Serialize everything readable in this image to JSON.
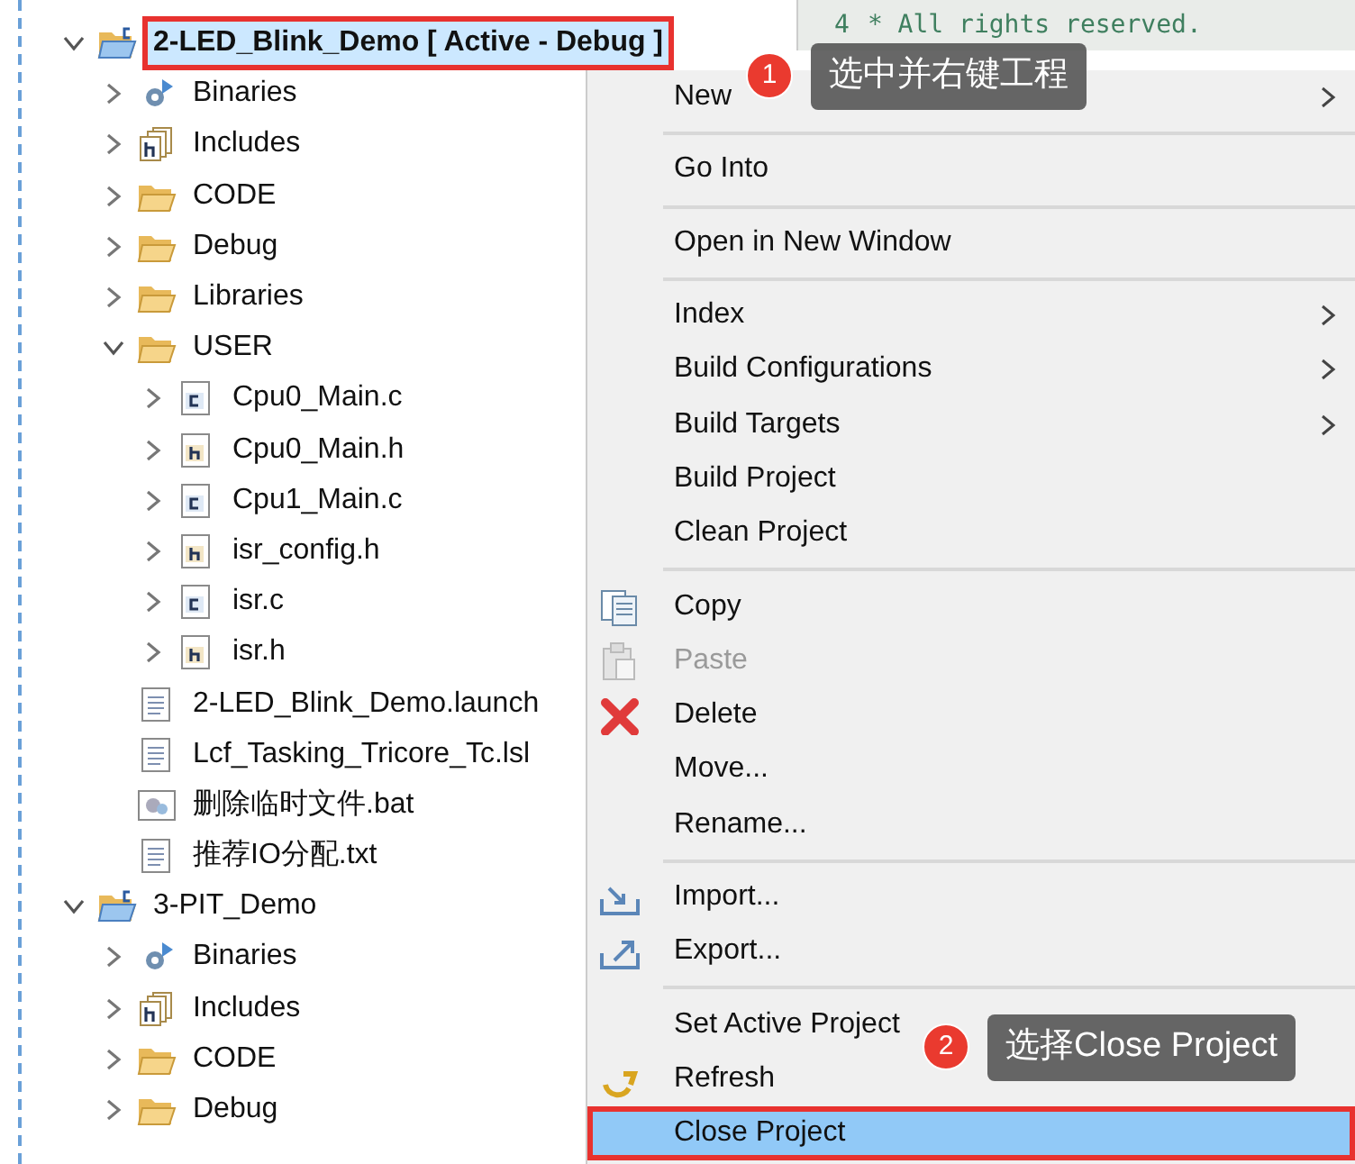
{
  "editor": {
    "line_number": "4",
    "code": "* All rights reserved."
  },
  "tree": [
    {
      "label": "2-LED_Blink_Demo [ Active - Debug ]",
      "kind": "project",
      "expanded": true,
      "selected": true,
      "highlighted": true,
      "children": [
        {
          "label": "Binaries",
          "kind": "binaries",
          "expanded": false,
          "selected": false
        },
        {
          "label": "Includes",
          "kind": "includes",
          "expanded": false,
          "selected": false
        },
        {
          "label": "CODE",
          "kind": "folder",
          "expanded": false,
          "selected": false
        },
        {
          "label": "Debug",
          "kind": "folder",
          "expanded": false,
          "selected": false
        },
        {
          "label": "Libraries",
          "kind": "folder",
          "expanded": false,
          "selected": false
        },
        {
          "label": "USER",
          "kind": "folder",
          "expanded": true,
          "selected": false,
          "children": [
            {
              "label": "Cpu0_Main.c",
              "kind": "c",
              "expanded": false,
              "selected": false
            },
            {
              "label": "Cpu0_Main.h",
              "kind": "h",
              "expanded": false,
              "selected": false
            },
            {
              "label": "Cpu1_Main.c",
              "kind": "c",
              "expanded": false,
              "selected": false
            },
            {
              "label": "isr_config.h",
              "kind": "h",
              "expanded": false,
              "selected": false
            },
            {
              "label": "isr.c",
              "kind": "c",
              "expanded": false,
              "selected": false
            },
            {
              "label": "isr.h",
              "kind": "h",
              "expanded": false,
              "selected": false
            }
          ]
        },
        {
          "label": "2-LED_Blink_Demo.launch",
          "kind": "file",
          "selected": false
        },
        {
          "label": "Lcf_Tasking_Tricore_Tc.lsl",
          "kind": "file",
          "selected": false
        },
        {
          "label": "删除临时文件.bat",
          "kind": "bat",
          "selected": false
        },
        {
          "label": "推荐IO分配.txt",
          "kind": "file",
          "selected": false
        }
      ]
    },
    {
      "label": "3-PIT_Demo",
      "kind": "project",
      "expanded": true,
      "selected": false,
      "highlighted": false,
      "children": [
        {
          "label": "Binaries",
          "kind": "binaries",
          "expanded": false,
          "selected": false
        },
        {
          "label": "Includes",
          "kind": "includes",
          "expanded": false,
          "selected": false
        },
        {
          "label": "CODE",
          "kind": "folder",
          "expanded": false,
          "selected": false
        },
        {
          "label": "Debug",
          "kind": "folder",
          "expanded": false,
          "selected": false
        }
      ]
    }
  ],
  "context_menu": [
    {
      "kind": "item",
      "label": "New",
      "submenu": true,
      "disabled": false,
      "selected": false
    },
    {
      "kind": "separator"
    },
    {
      "kind": "item",
      "label": "Go Into",
      "submenu": false,
      "disabled": false,
      "selected": false
    },
    {
      "kind": "separator"
    },
    {
      "kind": "item",
      "label": "Open in New Window",
      "submenu": false,
      "disabled": false,
      "selected": false
    },
    {
      "kind": "separator"
    },
    {
      "kind": "item",
      "label": "Index",
      "submenu": true,
      "disabled": false,
      "selected": false
    },
    {
      "kind": "item",
      "label": "Build Configurations",
      "submenu": true,
      "disabled": false,
      "selected": false
    },
    {
      "kind": "item",
      "label": "Build Targets",
      "submenu": true,
      "disabled": false,
      "selected": false
    },
    {
      "kind": "item",
      "label": "Build Project",
      "submenu": false,
      "disabled": false,
      "selected": false
    },
    {
      "kind": "item",
      "label": "Clean Project",
      "submenu": false,
      "disabled": false,
      "selected": false
    },
    {
      "kind": "separator"
    },
    {
      "kind": "copy",
      "label": "Copy",
      "submenu": false,
      "disabled": false,
      "selected": false
    },
    {
      "kind": "paste",
      "label": "Paste",
      "submenu": false,
      "disabled": true,
      "selected": false
    },
    {
      "kind": "delete",
      "label": "Delete",
      "submenu": false,
      "disabled": false,
      "selected": false
    },
    {
      "kind": "item",
      "label": "Move...",
      "submenu": false,
      "disabled": false,
      "selected": false
    },
    {
      "kind": "item",
      "label": "Rename...",
      "submenu": false,
      "disabled": false,
      "selected": false
    },
    {
      "kind": "separator"
    },
    {
      "kind": "import",
      "label": "Import...",
      "submenu": false,
      "disabled": false,
      "selected": false
    },
    {
      "kind": "export",
      "label": "Export...",
      "submenu": false,
      "disabled": false,
      "selected": false
    },
    {
      "kind": "separator"
    },
    {
      "kind": "item",
      "label": "Set Active Project",
      "submenu": false,
      "disabled": false,
      "selected": false
    },
    {
      "kind": "refresh",
      "label": "Refresh",
      "submenu": false,
      "disabled": false,
      "selected": false
    },
    {
      "kind": "item",
      "label": "Close Project",
      "submenu": false,
      "disabled": false,
      "selected": true
    }
  ],
  "callouts": [
    {
      "number": "1",
      "text": "选中并右键工程"
    },
    {
      "number": "2",
      "text": "选择Close Project"
    }
  ]
}
